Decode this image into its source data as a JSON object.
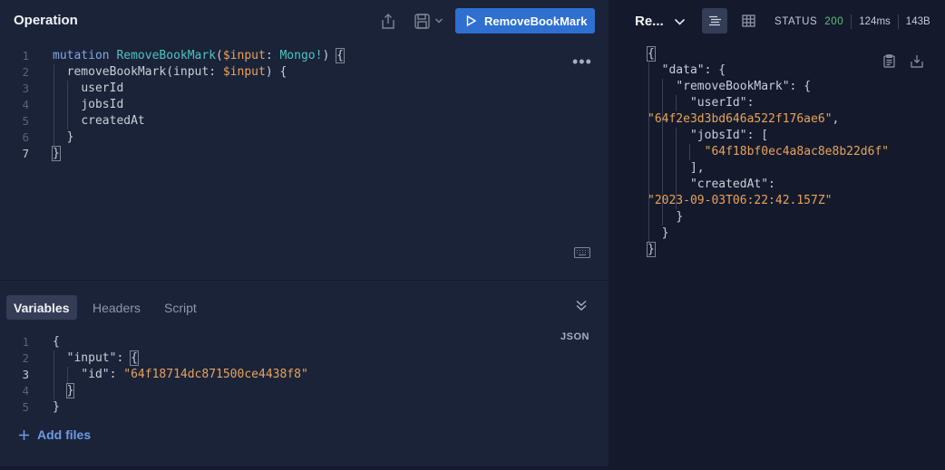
{
  "operation": {
    "title": "Operation",
    "run_label": "RemoveBookMark",
    "lines": [
      "1",
      "2",
      "3",
      "4",
      "5",
      "6",
      "7"
    ],
    "code": {
      "l1_kw": "mutation",
      "l1_name": "RemoveBookMark",
      "l1_open": "(",
      "l1_var": "$input",
      "l1_colon": ": ",
      "l1_type": "Mongo!",
      "l1_close": ")",
      "l1_brace": "{",
      "l2_field": "removeBookMark(input: ",
      "l2_var": "$input",
      "l2_close": ") {",
      "l3": "userId",
      "l4": "jobsId",
      "l5": "createdAt",
      "l6": "}",
      "l7": "}"
    }
  },
  "variables": {
    "tabs": [
      "Variables",
      "Headers",
      "Script"
    ],
    "format_label": "JSON",
    "lines": [
      "1",
      "2",
      "3",
      "4",
      "5"
    ],
    "code": {
      "l1": "{",
      "l2_key": "\"input\"",
      "l2_colon": ": ",
      "l2_brace": "{",
      "l3_key": "\"id\"",
      "l3_colon": ": ",
      "l3_val": "\"64f18714dc871500ce4438f8\"",
      "l4": "}",
      "l5": "}"
    },
    "add_files_label": "Add files"
  },
  "response": {
    "title": "Re...",
    "status_label": "STATUS",
    "status_code": "200",
    "time": "124ms",
    "size": "143B",
    "json": {
      "l1": "{",
      "l2": "\"data\": {",
      "l3": "\"removeBookMark\": {",
      "l4": "\"userId\":",
      "l5": "\"64f2e3d3bd646a522f176ae6\"",
      "l5_comma": ",",
      "l6": "\"jobsId\": [",
      "l7": "\"64f18bf0ec4a8ac8e8b22d6f\"",
      "l8": "],",
      "l9": "\"createdAt\":",
      "l10": "\"2023-09-03T06:22:42.157Z\"",
      "l11": "}",
      "l12": "}",
      "l13": "}"
    }
  },
  "colors": {
    "accent": "#2f6fd0",
    "status_ok": "#5ec27a",
    "string": "#e8a35a",
    "function": "#4fc3c0"
  }
}
